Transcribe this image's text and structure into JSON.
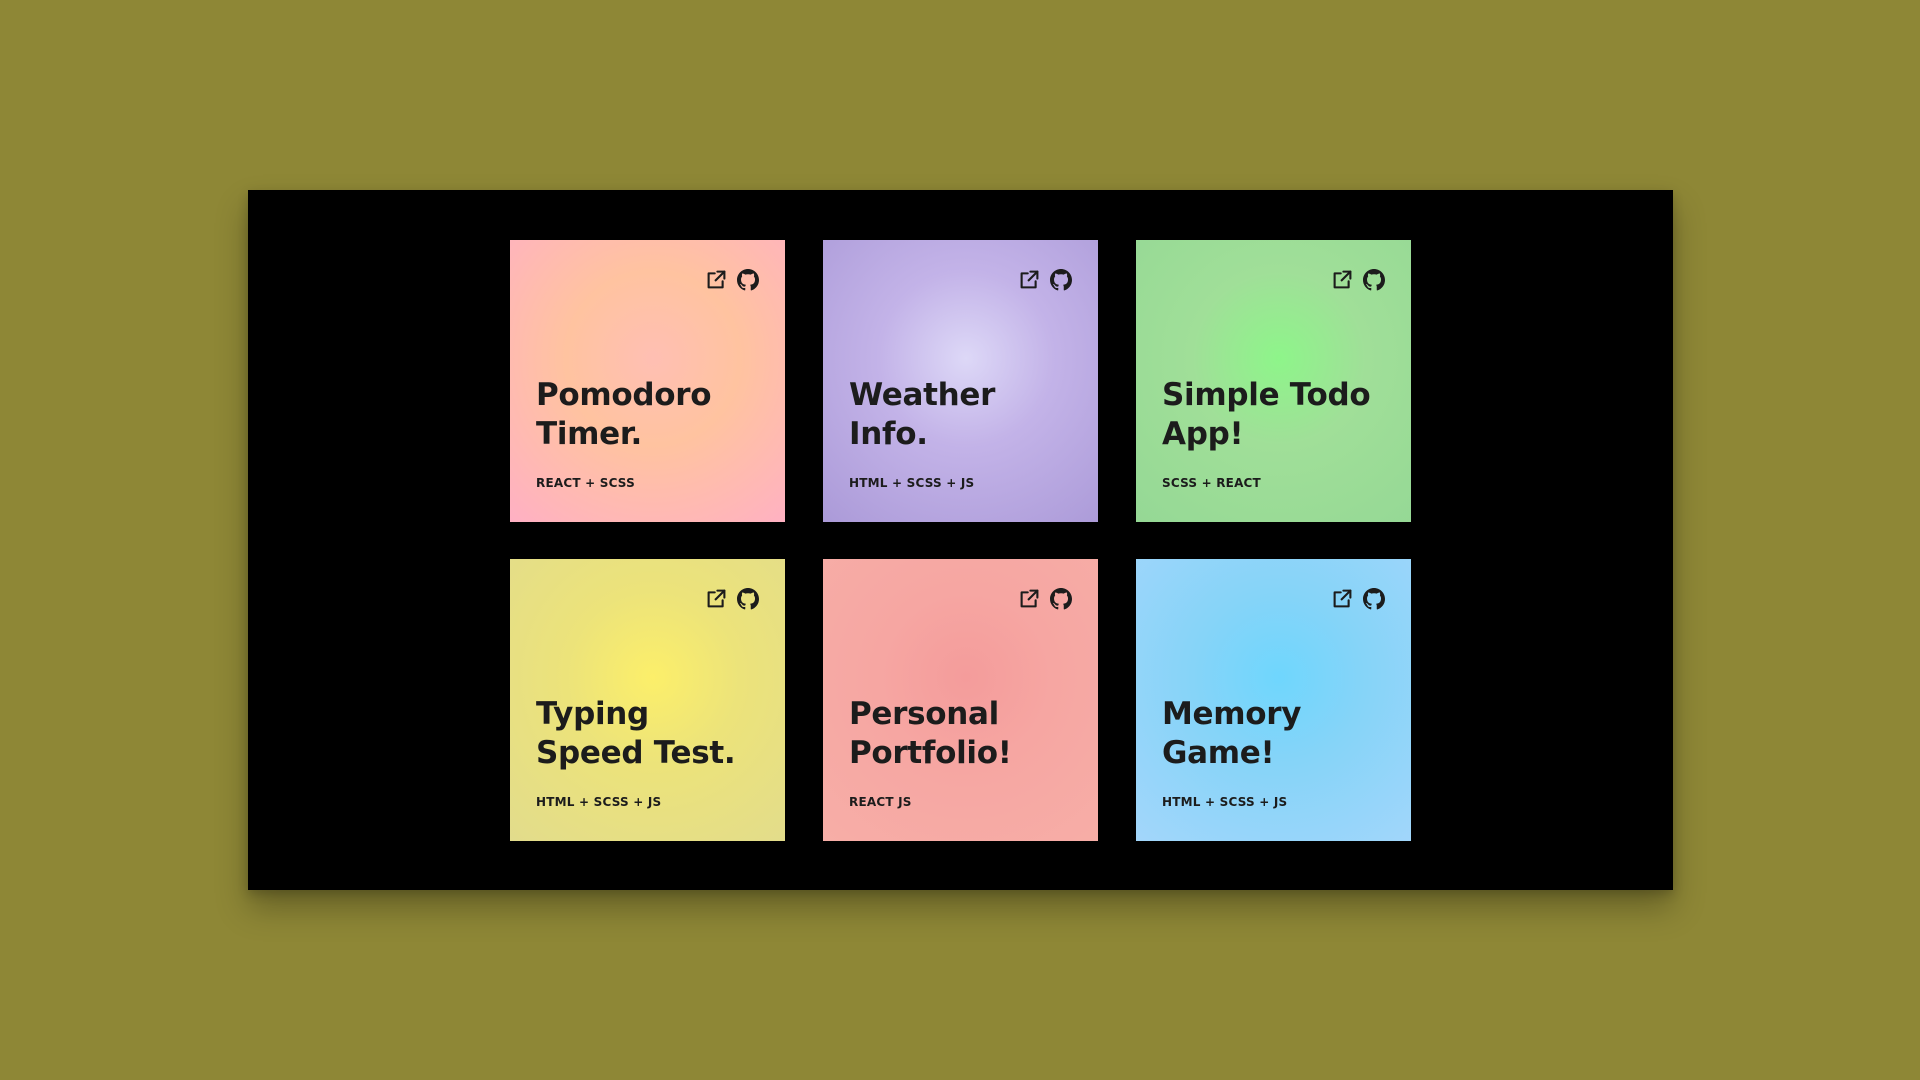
{
  "page": {
    "background_color": "#8e8736",
    "panel_color": "#000000"
  },
  "icons": {
    "live": "external-link-icon",
    "source": "github-icon"
  },
  "projects": [
    {
      "title": "Pomodoro\nTimer.",
      "tech": "REACT + SCSS",
      "gradient_center": "#ffbfb3",
      "gradient_edge": "#ffb0c4",
      "gradient_highlight": "#ffc3a0"
    },
    {
      "title": "Weather\nInfo.",
      "tech": "HTML + SCSS + JS",
      "gradient_center": "#ddd8f7",
      "gradient_edge": "#ab9ad8",
      "gradient_highlight": "#c3b3e8"
    },
    {
      "title": "Simple Todo\nApp!",
      "tech": "SCSS + REACT",
      "gradient_center": "#8ef58a",
      "gradient_edge": "#95d895",
      "gradient_highlight": "#a0df98"
    },
    {
      "title": "Typing\nSpeed Test.",
      "tech": "HTML + SCSS + JS",
      "gradient_center": "#fcef6a",
      "gradient_edge": "#e2dc8c",
      "gradient_highlight": "#ece37a"
    },
    {
      "title": "Personal\nPortfolio!",
      "tech": "REACT JS",
      "gradient_center": "#f49c9b",
      "gradient_edge": "#f7aea7",
      "gradient_highlight": "#f6a6a2"
    },
    {
      "title": "Memory\nGame!",
      "tech": "HTML + SCSS + JS",
      "gradient_center": "#6fd6fd",
      "gradient_edge": "#a3d6fb",
      "gradient_highlight": "#86d4f8"
    }
  ]
}
